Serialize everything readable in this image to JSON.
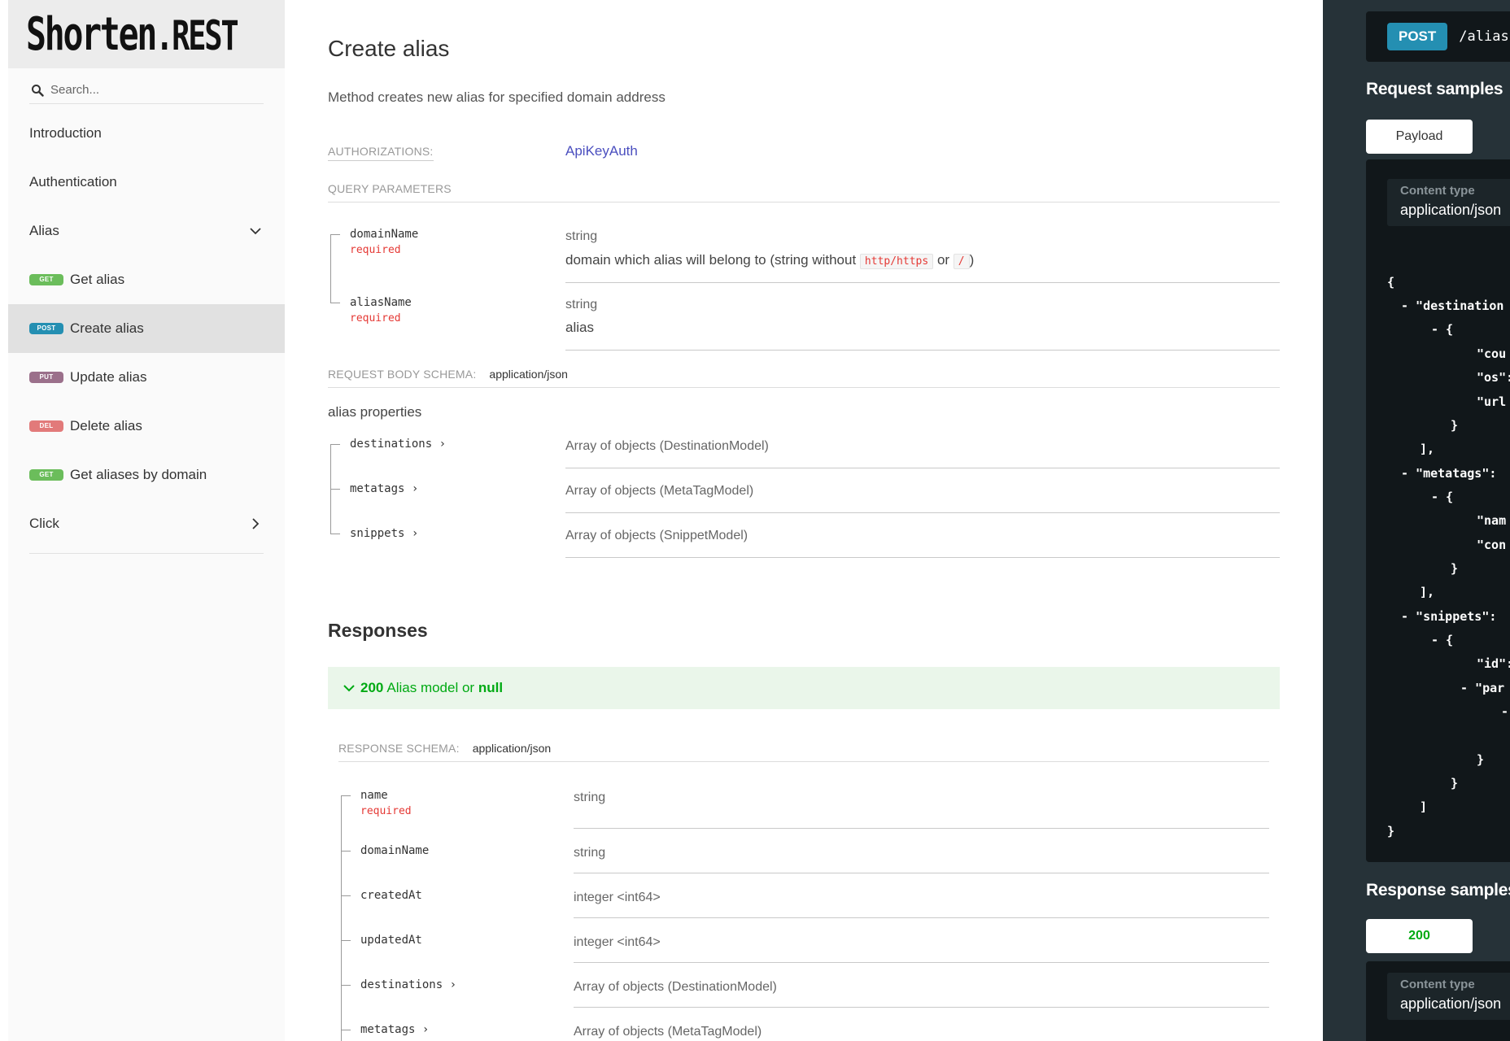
{
  "logo": {
    "name": "Shorten",
    "tld": ".REST"
  },
  "search": {
    "placeholder": "Search..."
  },
  "nav": {
    "introduction": "Introduction",
    "authentication": "Authentication",
    "alias": "Alias",
    "click": "Click",
    "items": [
      {
        "method": "GET",
        "label": "Get alias",
        "color": "#6bbd5b"
      },
      {
        "method": "POST",
        "label": "Create alias",
        "color": "#248fb2"
      },
      {
        "method": "PUT",
        "label": "Update alias",
        "color": "#9b708b"
      },
      {
        "method": "DEL",
        "label": "Delete alias",
        "color": "#e27a7a"
      },
      {
        "method": "GET",
        "label": "Get aliases by domain",
        "color": "#6bbd5b"
      }
    ]
  },
  "main": {
    "title": "Create alias",
    "description": "Method creates new alias for specified domain address",
    "authorizations_label": "AUTHORIZATIONS:",
    "auth_link": "ApiKeyAuth",
    "query_parameters_label": "QUERY PARAMETERS",
    "query_params": [
      {
        "name": "domainName",
        "required": "required",
        "type": "string",
        "desc_pre": "domain which alias will belong to (string without",
        "code1": "http/https",
        "desc_mid": "or",
        "code2": "/",
        "desc_post": ")"
      },
      {
        "name": "aliasName",
        "required": "required",
        "type": "string",
        "desc": "alias"
      }
    ],
    "request_body_label": "REQUEST BODY SCHEMA:",
    "request_body_type": "application/json",
    "alias_properties": "alias properties",
    "body_fields": [
      {
        "name": "destinations",
        "type": "Array of objects (DestinationModel)"
      },
      {
        "name": "metatags",
        "type": "Array of objects (MetaTagModel)"
      },
      {
        "name": "snippets",
        "type": "Array of objects (SnippetModel)"
      }
    ],
    "responses_title": "Responses",
    "response_200": {
      "code": "200",
      "text": "Alias model or",
      "null": "null"
    },
    "response_schema_label": "RESPONSE SCHEMA:",
    "response_schema_type": "application/json",
    "response_fields": [
      {
        "name": "name",
        "required": "required",
        "type": "string"
      },
      {
        "name": "domainName",
        "type": "string"
      },
      {
        "name": "createdAt",
        "type": "integer <int64>"
      },
      {
        "name": "updatedAt",
        "type": "integer <int64>"
      },
      {
        "name": "destinations",
        "type": "Array of objects (DestinationModel)"
      },
      {
        "name": "metatags",
        "type": "Array of objects (MetaTagModel)"
      }
    ]
  },
  "right": {
    "method": "POST",
    "path": "/alias",
    "request_samples": "Request samples",
    "payload_tab": "Payload",
    "content_type_label": "Content type",
    "content_type_value": "application/json",
    "json_lines": [
      "{",
      "- \"destination",
      "- {",
      "\"cou",
      "\"os\":",
      "\"url",
      "}",
      "],",
      "- \"metatags\":",
      "- {",
      "\"nam",
      "\"con",
      "}",
      "],",
      "- \"snippets\":",
      "- {",
      "\"id\":",
      "- \"par",
      "-",
      "-",
      "}",
      "}",
      "]",
      "}"
    ],
    "response_samples": "Response samples",
    "status_tab": "200",
    "status_color": "#00aa13",
    "resp_content_type_label": "Content type",
    "resp_content_type_value": "application/json"
  }
}
